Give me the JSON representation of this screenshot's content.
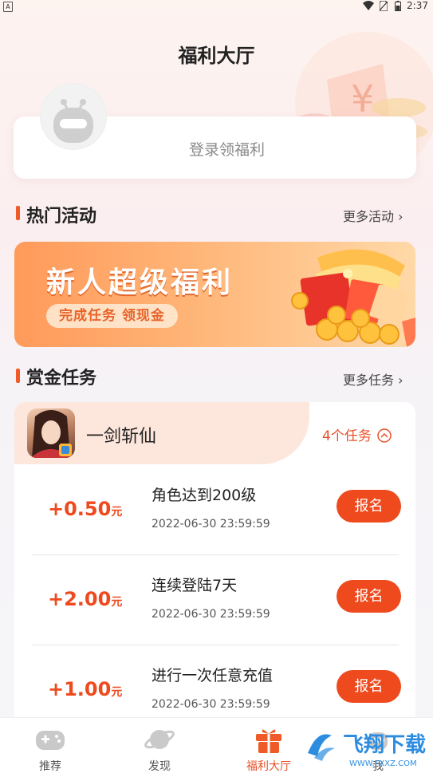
{
  "status_bar": {
    "badge": "A",
    "time": "2:37"
  },
  "header": {
    "title": "福利大厅"
  },
  "login": {
    "text": "登录领福利"
  },
  "hot": {
    "title": "热门活动",
    "more": "更多活动 ›"
  },
  "banner": {
    "title": "新人超级福利",
    "subtitle": "完成任务 领现金"
  },
  "bounty": {
    "title": "赏金任务",
    "more": "更多任务 ›"
  },
  "game": {
    "name": "一剑斩仙",
    "task_count": "4个任务"
  },
  "tasks": [
    {
      "reward": "+0.50",
      "unit": "元",
      "name": "角色达到200级",
      "date": "2022-06-30 23:59:59",
      "button": "报名"
    },
    {
      "reward": "+2.00",
      "unit": "元",
      "name": "连续登陆7天",
      "date": "2022-06-30 23:59:59",
      "button": "报名"
    },
    {
      "reward": "+1.00",
      "unit": "元",
      "name": "进行一次任意充值",
      "date": "2022-06-30 23:59:59",
      "button": "报名"
    }
  ],
  "tabs": [
    {
      "label": "推荐",
      "icon": "gamepad-icon"
    },
    {
      "label": "发现",
      "icon": "planet-icon"
    },
    {
      "label": "福利大厅",
      "icon": "gift-icon"
    },
    {
      "label": "我",
      "icon": "robot-icon"
    }
  ],
  "watermark": {
    "text": "飞翔下载",
    "sub": "WWW.FXXZ.COM"
  },
  "colors": {
    "accent": "#ee4a1e",
    "orange": "#f05a28",
    "banner": "#ff9a5a"
  }
}
